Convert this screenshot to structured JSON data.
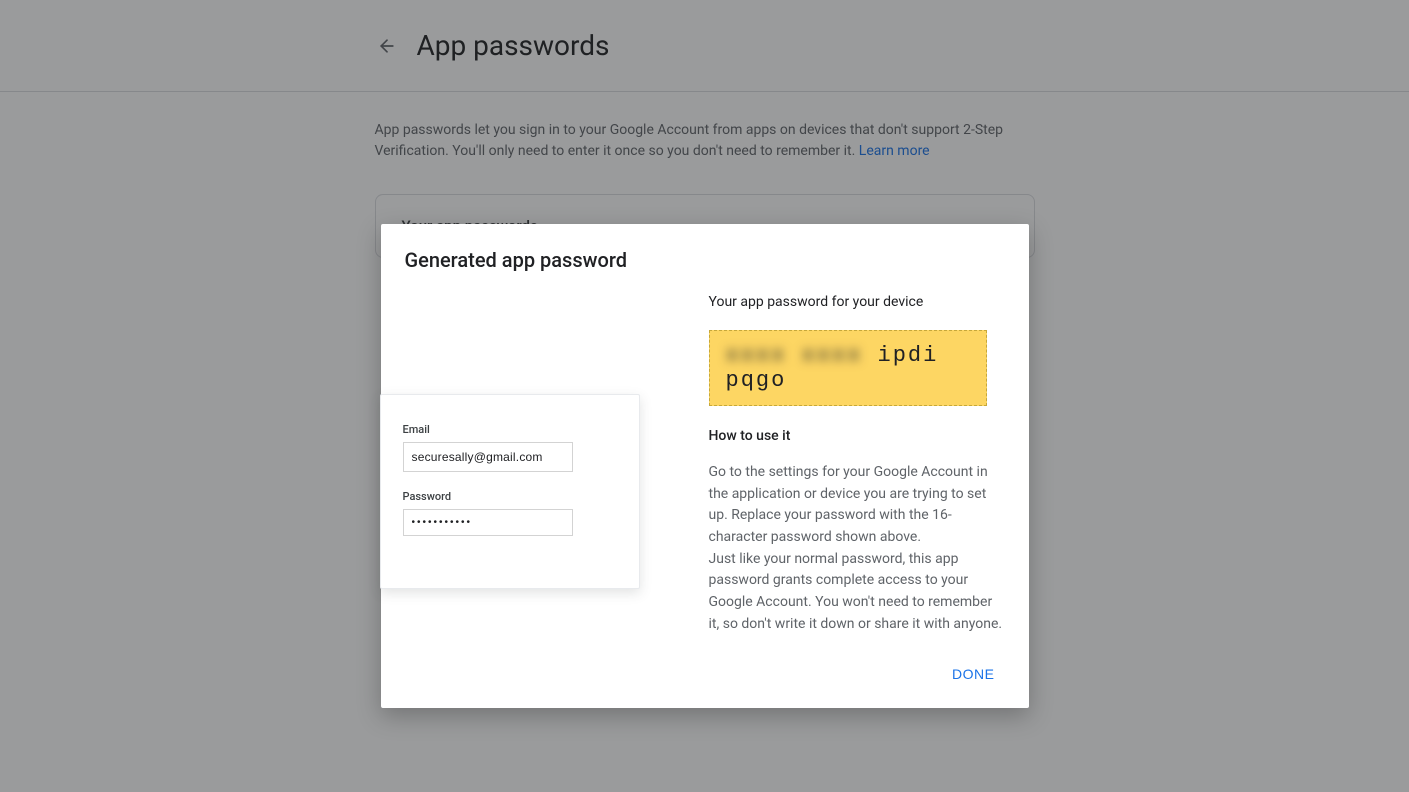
{
  "header": {
    "title": "App passwords"
  },
  "intro": {
    "text": "App passwords let you sign in to your Google Account from apps on devices that don't support 2-Step Verification. You'll only need to enter it once so you don't need to remember it. ",
    "learn_more": "Learn more"
  },
  "card": {
    "header": "Your app passwords"
  },
  "modal": {
    "title": "Generated app password",
    "device_label": "Your app password for your device",
    "password_blurred": "xxxx xxxx",
    "password_visible": " ipdi pqgo",
    "example": {
      "email_label": "Email",
      "email_value": "securesally@gmail.com",
      "password_label": "Password",
      "password_value": "•••••••••••"
    },
    "howto_heading": "How to use it",
    "howto_text1": "Go to the settings for your Google Account in the application or device you are trying to set up. Replace your password with the 16-character password shown above.",
    "howto_text2": "Just like your normal password, this app password grants complete access to your Google Account. You won't need to remember it, so don't write it down or share it with anyone.",
    "done_label": "DONE"
  }
}
